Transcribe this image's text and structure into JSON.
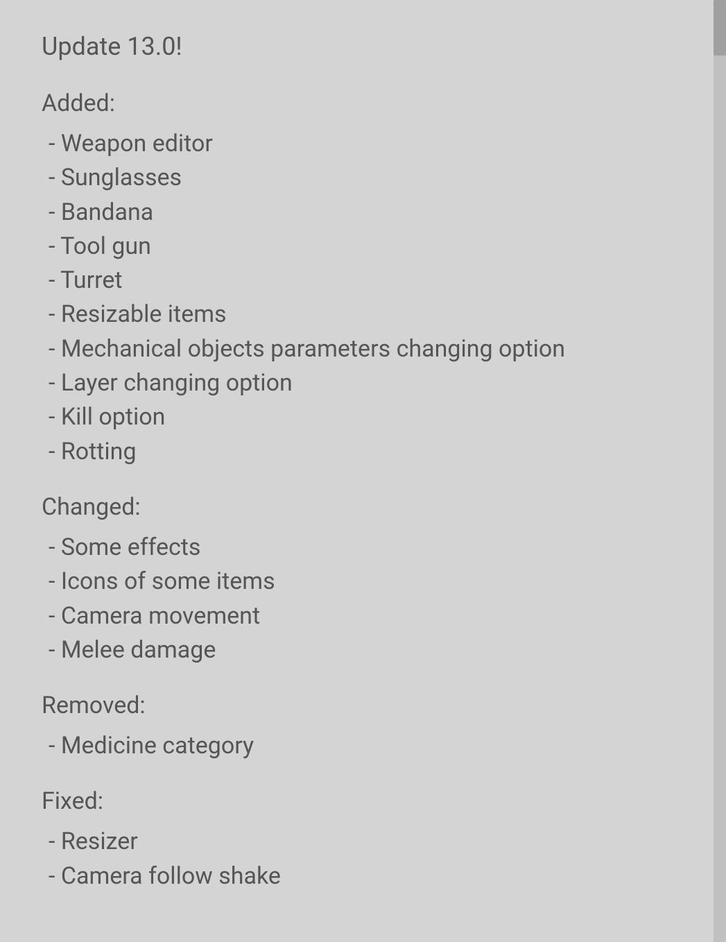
{
  "page": {
    "title": "Update 13.0!",
    "sections": [
      {
        "label": "Added:",
        "items": [
          "- Weapon editor",
          "- Sunglasses",
          "- Bandana",
          "- Tool gun",
          "- Turret",
          "- Resizable items",
          "- Mechanical objects parameters changing option",
          "- Layer changing option",
          "- Kill option",
          "- Rotting"
        ]
      },
      {
        "label": "Changed:",
        "items": [
          "- Some effects",
          "- Icons of some items",
          "- Camera movement",
          "- Melee damage"
        ]
      },
      {
        "label": "Removed:",
        "items": [
          "- Medicine category"
        ]
      },
      {
        "label": "Fixed:",
        "items": [
          "- Resizer",
          "- Camera follow shake"
        ]
      }
    ]
  }
}
